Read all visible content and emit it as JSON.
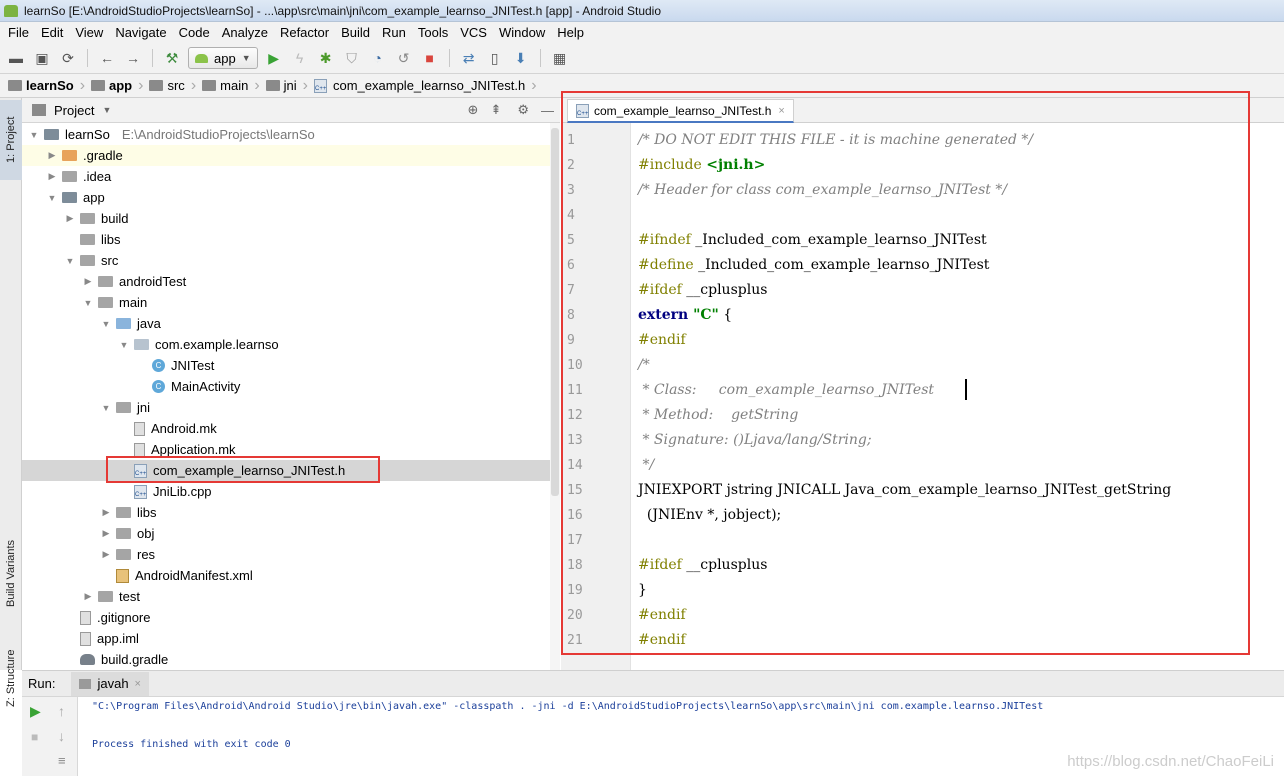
{
  "window": {
    "title": "learnSo [E:\\AndroidStudioProjects\\learnSo] - ...\\app\\src\\main\\jni\\com_example_learnso_JNITest.h [app] - Android Studio"
  },
  "menu": [
    "File",
    "Edit",
    "View",
    "Navigate",
    "Code",
    "Analyze",
    "Refactor",
    "Build",
    "Run",
    "Tools",
    "VCS",
    "Window",
    "Help"
  ],
  "toolbar": {
    "run_config": "app"
  },
  "breadcrumb": [
    "learnSo",
    "app",
    "src",
    "main",
    "jni",
    "com_example_learnso_JNITest.h"
  ],
  "left_tool_tabs": {
    "project": "1: Project",
    "build_variants": "Build Variants",
    "structure": "Z: Structure"
  },
  "project_panel": {
    "header": "Project",
    "root_label": "learnSo",
    "root_path": "E:\\AndroidStudioProjects\\learnSo",
    "tree": [
      {
        "label": "learnSo",
        "depth": 0,
        "arrow": "open",
        "icon": "module"
      },
      {
        "label": ".gradle",
        "depth": 1,
        "arrow": "closed",
        "icon": "folder-orange"
      },
      {
        "label": ".idea",
        "depth": 1,
        "arrow": "closed",
        "icon": "folder"
      },
      {
        "label": "app",
        "depth": 1,
        "arrow": "open",
        "icon": "module"
      },
      {
        "label": "build",
        "depth": 2,
        "arrow": "closed",
        "icon": "folder"
      },
      {
        "label": "libs",
        "depth": 2,
        "arrow": "none",
        "icon": "folder"
      },
      {
        "label": "src",
        "depth": 2,
        "arrow": "open",
        "icon": "folder"
      },
      {
        "label": "androidTest",
        "depth": 3,
        "arrow": "closed",
        "icon": "folder"
      },
      {
        "label": "main",
        "depth": 3,
        "arrow": "open",
        "icon": "folder"
      },
      {
        "label": "java",
        "depth": 4,
        "arrow": "open",
        "icon": "folder-blue"
      },
      {
        "label": "com.example.learnso",
        "depth": 5,
        "arrow": "open",
        "icon": "package"
      },
      {
        "label": "JNITest",
        "depth": 6,
        "arrow": "none",
        "icon": "class"
      },
      {
        "label": "MainActivity",
        "depth": 6,
        "arrow": "none",
        "icon": "class"
      },
      {
        "label": "jni",
        "depth": 4,
        "arrow": "open",
        "icon": "folder"
      },
      {
        "label": "Android.mk",
        "depth": 5,
        "arrow": "none",
        "icon": "file"
      },
      {
        "label": "Application.mk",
        "depth": 5,
        "arrow": "none",
        "icon": "file"
      },
      {
        "label": "com_example_learnso_JNITest.h",
        "depth": 5,
        "arrow": "none",
        "icon": "cpp-header",
        "selected": true
      },
      {
        "label": "JniLib.cpp",
        "depth": 5,
        "arrow": "none",
        "icon": "cpp-header"
      },
      {
        "label": "libs",
        "depth": 4,
        "arrow": "closed",
        "icon": "folder"
      },
      {
        "label": "obj",
        "depth": 4,
        "arrow": "closed",
        "icon": "folder"
      },
      {
        "label": "res",
        "depth": 4,
        "arrow": "closed",
        "icon": "folder"
      },
      {
        "label": "AndroidManifest.xml",
        "depth": 4,
        "arrow": "none",
        "icon": "xml"
      },
      {
        "label": "test",
        "depth": 3,
        "arrow": "closed",
        "icon": "folder"
      },
      {
        "label": ".gitignore",
        "depth": 2,
        "arrow": "none",
        "icon": "file"
      },
      {
        "label": "app.iml",
        "depth": 2,
        "arrow": "none",
        "icon": "file"
      },
      {
        "label": "build.gradle",
        "depth": 2,
        "arrow": "none",
        "icon": "gradle"
      }
    ]
  },
  "editor": {
    "tab_label": "com_example_learnso_JNITest.h",
    "lines": [
      {
        "n": "1",
        "parts": [
          {
            "t": "/* DO NOT EDIT THIS FILE - it is machine generated */",
            "c": "cmt"
          }
        ]
      },
      {
        "n": "2",
        "parts": [
          {
            "t": "#include ",
            "c": "pp"
          },
          {
            "t": "<jni.h>",
            "c": "str"
          }
        ]
      },
      {
        "n": "3",
        "parts": [
          {
            "t": "/* Header for class com_example_learnso_JNITest */",
            "c": "cmt"
          }
        ]
      },
      {
        "n": "4",
        "parts": []
      },
      {
        "n": "5",
        "parts": [
          {
            "t": "#ifndef ",
            "c": "pp"
          },
          {
            "t": "_Included_com_example_learnso_JNITest",
            "c": ""
          }
        ]
      },
      {
        "n": "6",
        "parts": [
          {
            "t": "#define ",
            "c": "pp"
          },
          {
            "t": "_Included_com_example_learnso_JNITest",
            "c": ""
          }
        ]
      },
      {
        "n": "7",
        "parts": [
          {
            "t": "#ifdef ",
            "c": "pp"
          },
          {
            "t": "__cplusplus",
            "c": ""
          }
        ]
      },
      {
        "n": "8",
        "parts": [
          {
            "t": "extern ",
            "c": "kw"
          },
          {
            "t": "\"C\"",
            "c": "str"
          },
          {
            "t": " {",
            "c": ""
          }
        ]
      },
      {
        "n": "9",
        "parts": [
          {
            "t": "#endif",
            "c": "pp"
          }
        ]
      },
      {
        "n": "10",
        "parts": [
          {
            "t": "/*",
            "c": "cmt"
          }
        ]
      },
      {
        "n": "11",
        "parts": [
          {
            "t": " * Class:     com_example_learnso_JNITest",
            "c": "cmt"
          }
        ]
      },
      {
        "n": "12",
        "parts": [
          {
            "t": " * Method:    getString",
            "c": "cmt"
          }
        ]
      },
      {
        "n": "13",
        "parts": [
          {
            "t": " * Signature: ()Ljava/lang/String;",
            "c": "cmt"
          }
        ]
      },
      {
        "n": "14",
        "parts": [
          {
            "t": " */",
            "c": "cmt"
          }
        ]
      },
      {
        "n": "15",
        "parts": [
          {
            "t": "JNIEXPORT jstring JNICALL Java_com_example_learnso_JNITest_getString",
            "c": ""
          }
        ]
      },
      {
        "n": "16",
        "parts": [
          {
            "t": "  (JNIEnv *, jobject);",
            "c": ""
          }
        ]
      },
      {
        "n": "17",
        "parts": []
      },
      {
        "n": "18",
        "parts": [
          {
            "t": "#ifdef ",
            "c": "pp"
          },
          {
            "t": "__cplusplus",
            "c": ""
          }
        ]
      },
      {
        "n": "19",
        "parts": [
          {
            "t": "}",
            "c": ""
          }
        ]
      },
      {
        "n": "20",
        "parts": [
          {
            "t": "#endif",
            "c": "pp"
          }
        ]
      },
      {
        "n": "21",
        "parts": [
          {
            "t": "#endif",
            "c": "pp"
          }
        ]
      }
    ]
  },
  "run_panel": {
    "label": "Run:",
    "tab_label": "javah",
    "command": "\"C:\\Program Files\\Android\\Android Studio\\jre\\bin\\javah.exe\" -classpath . -jni -d E:\\AndroidStudioProjects\\learnSo\\app\\src\\main\\jni com.example.learnso.JNITest",
    "result": "Process finished with exit code 0"
  },
  "watermark": "https://blog.csdn.net/ChaoFeiLi"
}
